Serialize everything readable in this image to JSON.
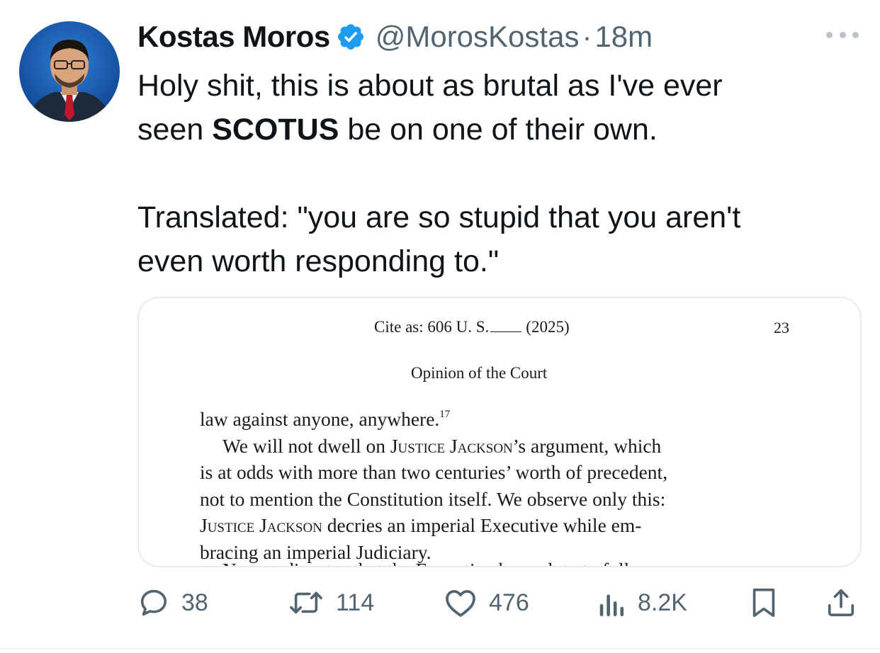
{
  "tweet": {
    "author_name": "Kostas Moros",
    "handle": "@MorosKostas",
    "separator": "·",
    "time": "18m",
    "text_line1": "Holy shit, this is about as brutal as I've ever",
    "text_line2_pre": "seen ",
    "text_line2_bold": "SCOTUS",
    "text_line2_post": " be on one of their own.",
    "text_line3": "Translated: \"you are so stupid that you aren't",
    "text_line4": "even worth responding to.\""
  },
  "document": {
    "cite_prefix": "Cite as:  606 U. S.",
    "cite_year": "(2025)",
    "page_number": "23",
    "section": "Opinion of the Court",
    "lines": [
      "law against anyone, anywhere.",
      "We will not dwell on ",
      "’s argument, which",
      "is at odds with more than two centuries’ worth of precedent,",
      "not to mention the Constitution itself.  We observe only this:",
      " decries an imperial Executive while em-",
      "bracing an imperial Judiciary."
    ],
    "footnote_mark": "17",
    "justice_name": "Justice Jackson",
    "cutoff_line": "No one disputes that the Executive has a duty to follow"
  },
  "actions": {
    "replies": "38",
    "reposts": "114",
    "likes": "476",
    "views": "8.2K"
  },
  "colors": {
    "text": "#0f1419",
    "secondary": "#536471",
    "verified": "#1d9bf0",
    "card_border": "#e6ebee"
  },
  "icons": [
    "verified-badge-icon",
    "more-icon",
    "reply-icon",
    "repost-icon",
    "like-icon",
    "views-icon",
    "bookmark-icon",
    "share-icon"
  ]
}
